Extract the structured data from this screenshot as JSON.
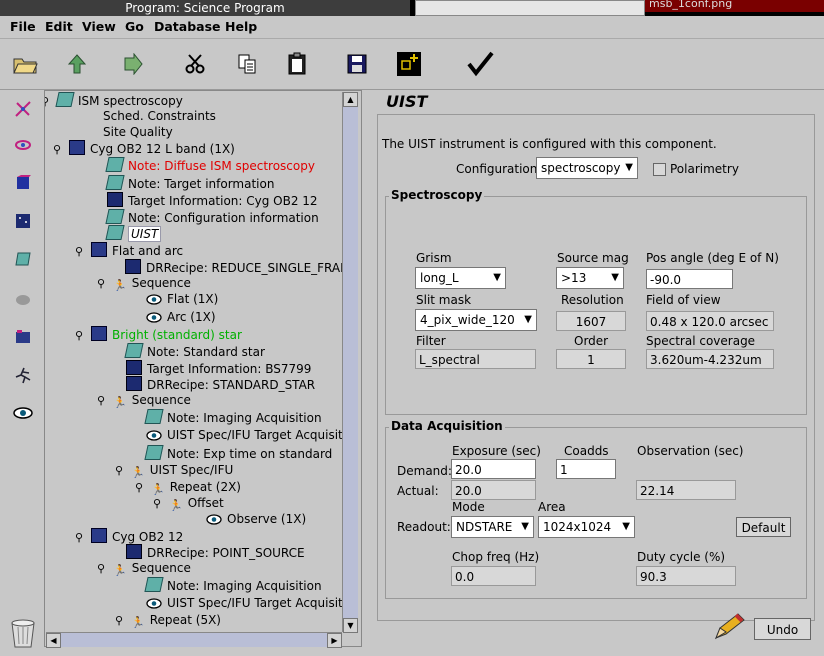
{
  "window": {
    "title": "Program: Science Program",
    "right_tab": "msb_1conf.png"
  },
  "menu": [
    "File",
    "Edit",
    "View",
    "Go",
    "Database",
    "Help"
  ],
  "toolbar_icons": [
    "open-folder-icon",
    "upload-icon",
    "download-icon",
    "cut-icon",
    "copy-icon",
    "paste-icon",
    "save-icon",
    "add-icon",
    "validate-icon"
  ],
  "left_icons": [
    "pointer-icon",
    "target-icon",
    "cube-icon",
    "image-icon",
    "note-icon",
    "cloud-icon",
    "folder-icon",
    "runner-icon",
    "eye-icon"
  ],
  "tree": [
    {
      "label": "ISM spectroscopy",
      "icon": "program",
      "color": "#000"
    },
    {
      "label": "Sched. Constraints",
      "icon": "blank",
      "color": "#000"
    },
    {
      "label": "Site Quality",
      "icon": "blank",
      "color": "#000"
    },
    {
      "label": "Cyg OB2 12 L band (1X)",
      "icon": "folder",
      "color": "#000"
    },
    {
      "label": "Note: Diffuse ISM spectroscopy",
      "icon": "note",
      "color": "#e00000"
    },
    {
      "label": "Note: Target information",
      "icon": "note",
      "color": "#000"
    },
    {
      "label": "Target Information: Cyg OB2 12",
      "icon": "target",
      "color": "#000"
    },
    {
      "label": "Note: Configuration information",
      "icon": "note",
      "color": "#000"
    },
    {
      "label": "UIST",
      "icon": "note",
      "color": "#000"
    },
    {
      "label": "Flat and arc",
      "icon": "folder",
      "color": "#000"
    },
    {
      "label": "DRRecipe: REDUCE_SINGLE_FRAM",
      "icon": "target",
      "color": "#000"
    },
    {
      "label": "Sequence",
      "icon": "seq",
      "color": "#000"
    },
    {
      "label": "Flat (1X)",
      "icon": "eye",
      "color": "#000"
    },
    {
      "label": "Arc (1X)",
      "icon": "eye",
      "color": "#000"
    },
    {
      "label": "Bright (standard) star",
      "icon": "folder",
      "color": "#00b000"
    },
    {
      "label": "Note: Standard star",
      "icon": "note",
      "color": "#000"
    },
    {
      "label": "Target Information: BS7799",
      "icon": "target",
      "color": "#000"
    },
    {
      "label": "DRRecipe: STANDARD_STAR",
      "icon": "target",
      "color": "#000"
    },
    {
      "label": "Sequence",
      "icon": "seq",
      "color": "#000"
    },
    {
      "label": "Note: Imaging Acquisition",
      "icon": "note",
      "color": "#000"
    },
    {
      "label": "UIST Spec/IFU Target Acquisiti",
      "icon": "eye",
      "color": "#000"
    },
    {
      "label": "Note: Exp time on standard",
      "icon": "note",
      "color": "#000"
    },
    {
      "label": "UIST Spec/IFU",
      "icon": "seq",
      "color": "#000"
    },
    {
      "label": "Repeat (2X)",
      "icon": "seq",
      "color": "#000"
    },
    {
      "label": "Offset",
      "icon": "seq",
      "color": "#000"
    },
    {
      "label": "Observe (1X)",
      "icon": "eye",
      "color": "#000"
    },
    {
      "label": "Cyg OB2 12",
      "icon": "folder",
      "color": "#000"
    },
    {
      "label": "DRRecipe: POINT_SOURCE",
      "icon": "target",
      "color": "#000"
    },
    {
      "label": "Sequence",
      "icon": "seq",
      "color": "#000"
    },
    {
      "label": "Note: Imaging Acquisition",
      "icon": "note",
      "color": "#000"
    },
    {
      "label": "UIST Spec/IFU Target Acquisiti",
      "icon": "eye",
      "color": "#000"
    },
    {
      "label": "Repeat (5X)",
      "icon": "seq",
      "color": "#000"
    }
  ],
  "uist": {
    "title": "UIST",
    "intro": "The UIST instrument is configured with this component.",
    "configuration_label": "Configuration",
    "configuration_value": "spectroscopy",
    "polarimetry_label": "Polarimetry",
    "polarimetry_checked": false,
    "spectroscopy": {
      "title": "Spectroscopy",
      "grism_label": "Grism",
      "grism_value": "long_L",
      "source_mag_label": "Source mag",
      "source_mag_value": ">13",
      "pos_angle_label": "Pos angle (deg E of N)",
      "pos_angle_value": "-90.0",
      "slit_mask_label": "Slit mask",
      "slit_mask_value": "4_pix_wide_120",
      "resolution_label": "Resolution",
      "resolution_value": "1607",
      "fov_label": "Field of view",
      "fov_value": "0.48 x 120.0 arcsec",
      "filter_label": "Filter",
      "filter_value": "L_spectral",
      "order_label": "Order",
      "order_value": "1",
      "coverage_label": "Spectral coverage",
      "coverage_value": "3.620um-4.232um"
    },
    "acquisition": {
      "title": "Data Acquisition",
      "exposure_label": "Exposure (sec)",
      "coadds_label": "Coadds",
      "observation_label": "Observation (sec)",
      "demand_label": "Demand:",
      "actual_label": "Actual:",
      "demand_exposure": "20.0",
      "demand_coadds": "1",
      "actual_exposure": "20.0",
      "actual_observation": "22.14",
      "mode_label": "Mode",
      "area_label": "Area",
      "readout_label": "Readout:",
      "mode_value": "NDSTARE",
      "area_value": "1024x1024",
      "default_button": "Default",
      "chop_label": "Chop freq (Hz)",
      "chop_value": "0.0",
      "duty_label": "Duty cycle (%)",
      "duty_value": "90.3"
    },
    "undo_button": "Undo"
  }
}
